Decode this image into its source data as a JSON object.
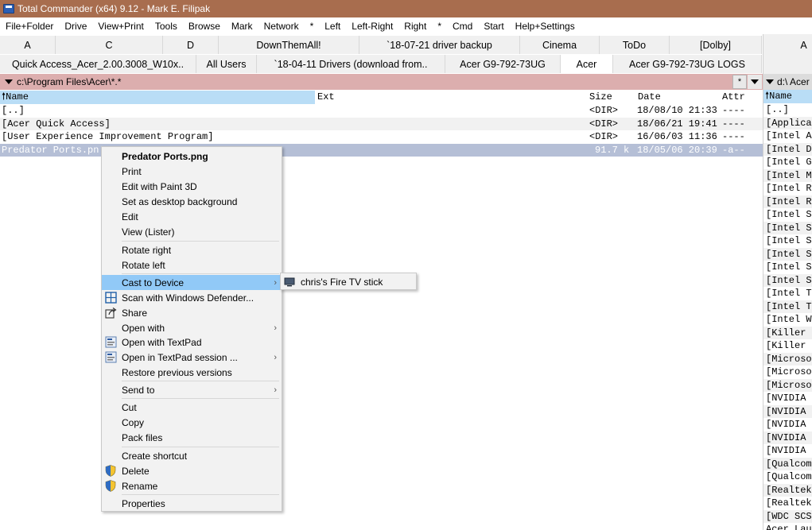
{
  "window": {
    "title": "Total Commander (x64) 9.12 - Mark E. Filipak"
  },
  "menubar": [
    "File+Folder",
    "Drive",
    "View+Print",
    "Tools",
    "Browse",
    "Mark",
    "Network",
    "*",
    "Left",
    "Left-Right",
    "Right",
    "*",
    "Cmd",
    "Start",
    "Help+Settings"
  ],
  "tabs_row1": [
    "A",
    "C",
    "D",
    "DownThemAll!",
    "`18-07-21 driver backup",
    "Cinema",
    "ToDo",
    "[Dolby]"
  ],
  "tabs_row2": [
    "Quick Access_Acer_2.00.3008_W10x..",
    "All Users",
    "`18-04-11 Drivers (download from..",
    "Acer G9-792-73UG",
    "Acer",
    "Acer G9-792-73UG LOGS"
  ],
  "left_panel": {
    "path": "c:\\Program Files\\Acer\\*.*",
    "star_button": "*",
    "columns": {
      "name": "Name",
      "ext": "Ext",
      "size": "Size",
      "date": "Date",
      "attr": "Attr"
    },
    "rows": [
      {
        "name": "[..]",
        "ext": "",
        "size": "<DIR>",
        "date": "18/08/10 21:33",
        "attr": "----"
      },
      {
        "name": "[Acer Quick Access]",
        "ext": "",
        "size": "<DIR>",
        "date": "18/06/21 19:41",
        "attr": "----"
      },
      {
        "name": "[User Experience Improvement Program]",
        "ext": "",
        "size": "<DIR>",
        "date": "16/06/03 11:36",
        "attr": "----"
      },
      {
        "name": "Predator Ports.pn",
        "ext": "",
        "size": "91.7 k",
        "date": "18/05/06 20:39",
        "attr": "-a--"
      }
    ]
  },
  "right_panel": {
    "tab": "A",
    "path": "d:\\ Acer",
    "column_name": "Name",
    "items": [
      "[..]",
      "[Applica",
      "[Intel A",
      "[Intel D",
      "[Intel G",
      "[Intel M",
      "[Intel R",
      "[Intel R",
      "[Intel S",
      "[Intel S",
      "[Intel S",
      "[Intel S",
      "[Intel S",
      "[Intel S",
      "[Intel T",
      "[Intel T",
      "[Intel W",
      "[Killer",
      "[Killer",
      "[Microso",
      "[Microso",
      "[Microso",
      "[NVIDIA",
      "[NVIDIA",
      "[NVIDIA",
      "[NVIDIA",
      "[NVIDIA",
      "[Qualcom",
      "[Qualcom",
      "[Realtek",
      "[Realtek",
      "[WDC SCS",
      "Acer Lau"
    ]
  },
  "context_menu": {
    "header": "Predator Ports.png",
    "items": {
      "print": "Print",
      "edit_paint3d": "Edit with Paint 3D",
      "set_desktop": "Set as desktop background",
      "edit": "Edit",
      "view_lister": "View (Lister)",
      "rotate_right": "Rotate right",
      "rotate_left": "Rotate left",
      "cast": "Cast to Device",
      "scan": "Scan with Windows Defender...",
      "share": "Share",
      "open_with": "Open with",
      "open_textpad": "Open with TextPad",
      "open_textpad_session": "Open in TextPad session ...",
      "restore": "Restore previous versions",
      "send_to": "Send to",
      "cut": "Cut",
      "copy": "Copy",
      "pack": "Pack files",
      "create_shortcut": "Create shortcut",
      "delete": "Delete",
      "rename": "Rename",
      "properties": "Properties"
    },
    "submenu_arrow": "›"
  },
  "submenu": {
    "device": "chris's Fire TV stick"
  },
  "colors": {
    "titlebar": "#a86d4e",
    "path_active": "#dcaeae",
    "name_header": "#b9ddf6",
    "selection": "#b5bfd6",
    "menu_highlight": "#91c9f7"
  }
}
